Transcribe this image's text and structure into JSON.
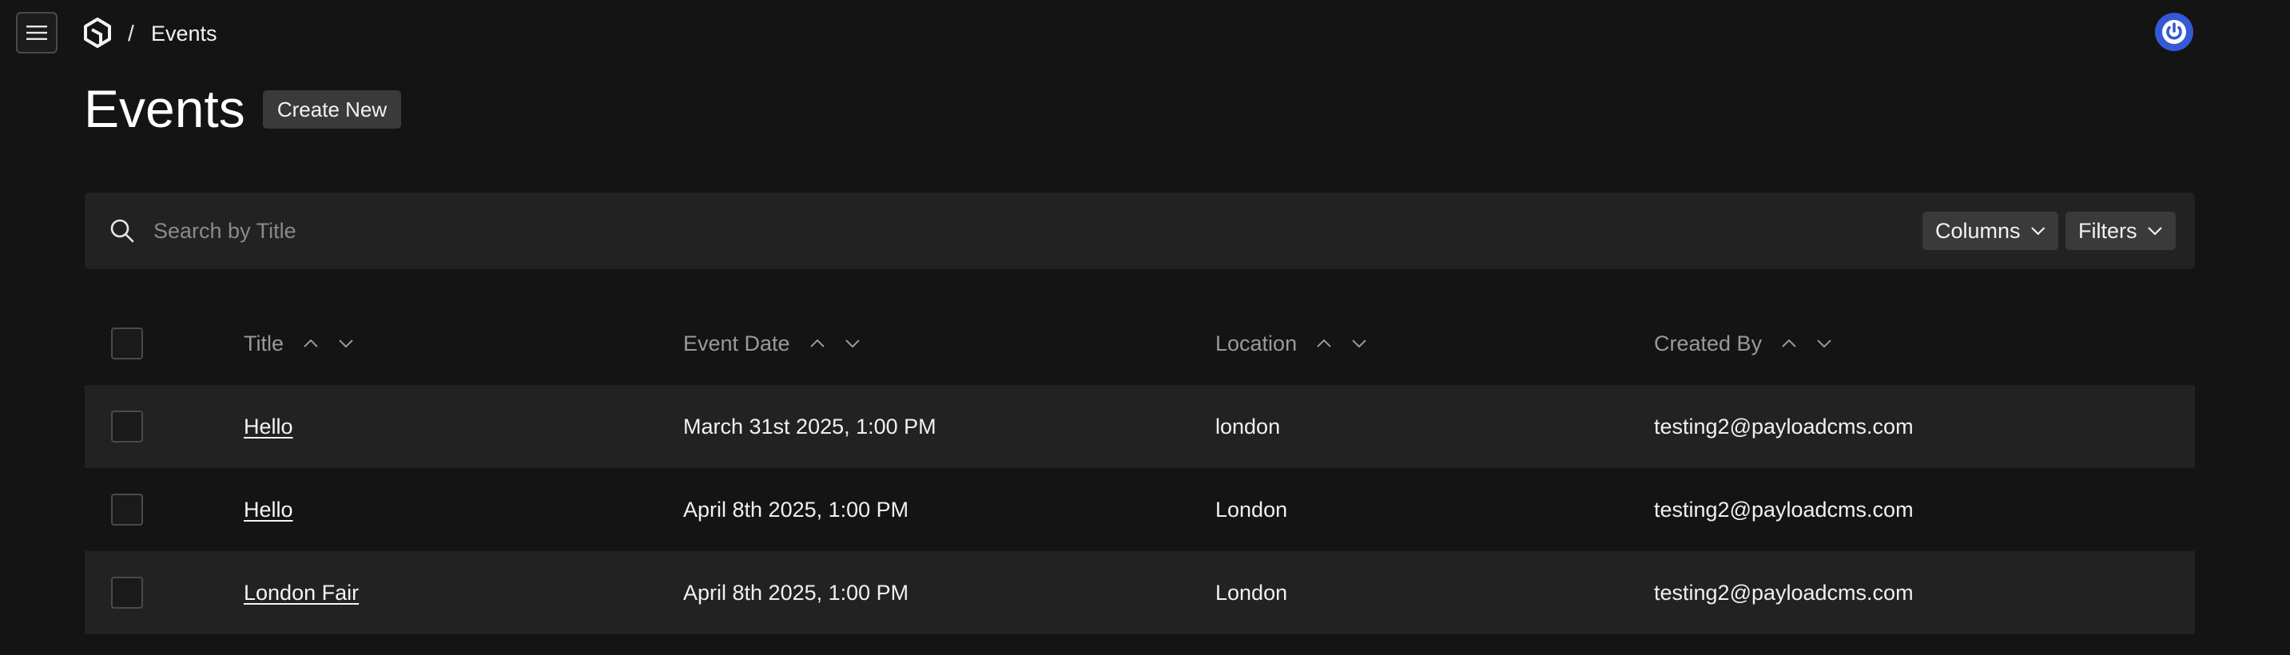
{
  "breadcrumb": {
    "separator": "/",
    "current": "Events"
  },
  "page": {
    "title": "Events",
    "create_label": "Create New"
  },
  "search": {
    "placeholder": "Search by Title",
    "value": ""
  },
  "toolbar": {
    "columns_label": "Columns",
    "filters_label": "Filters"
  },
  "table": {
    "headers": [
      "Title",
      "Event Date",
      "Location",
      "Created By"
    ],
    "rows": [
      {
        "title": "Hello",
        "event_date": "March 31st 2025, 1:00 PM",
        "location": "london",
        "created_by": "testing2@payloadcms.com"
      },
      {
        "title": "Hello",
        "event_date": "April 8th 2025, 1:00 PM",
        "location": "London",
        "created_by": "testing2@payloadcms.com"
      },
      {
        "title": "London Fair",
        "event_date": "April 8th 2025, 1:00 PM",
        "location": "London",
        "created_by": "testing2@payloadcms.com"
      }
    ]
  },
  "icons": {
    "menu": "hamburger-icon",
    "logo": "payload-logo-icon",
    "account": "power-icon",
    "search": "search-icon",
    "chevron": "chevron-down-icon",
    "sort_asc": "chevron-up-icon",
    "sort_desc": "chevron-down-icon"
  },
  "colors": {
    "background": "#141414",
    "surface": "#222222",
    "button": "#3a3a3a",
    "account_accent": "#3559d6"
  }
}
